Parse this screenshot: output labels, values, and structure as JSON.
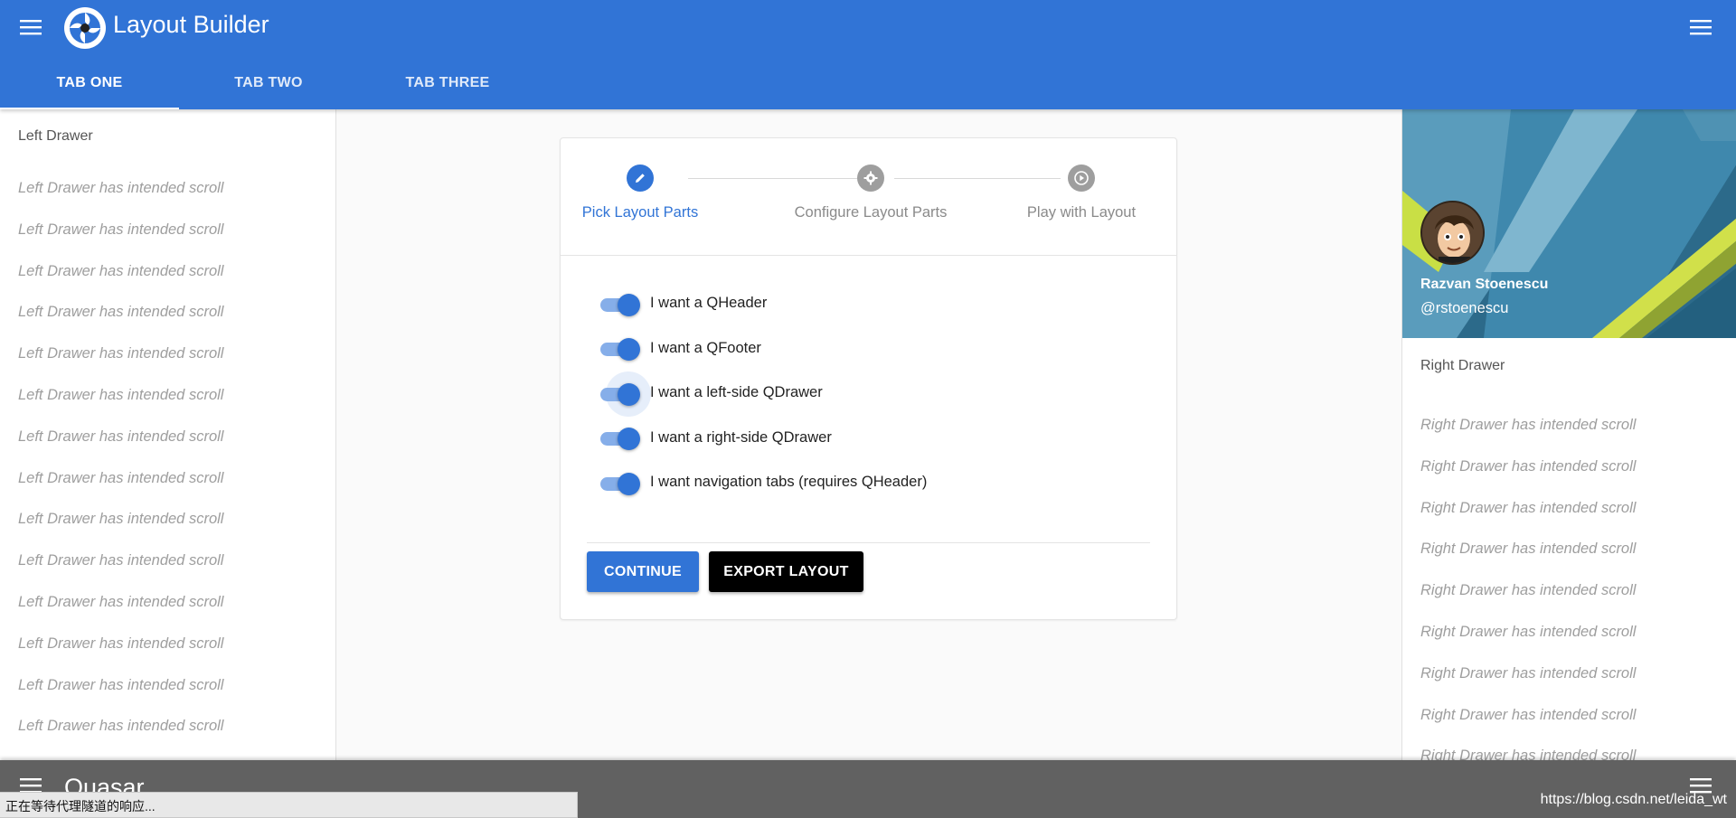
{
  "header": {
    "title": "Layout Builder",
    "tabs": [
      {
        "label": "TAB ONE",
        "active": true
      },
      {
        "label": "TAB TWO",
        "active": false
      },
      {
        "label": "TAB THREE",
        "active": false
      }
    ]
  },
  "left_drawer": {
    "title": "Left Drawer",
    "scroll_text": "Left Drawer has intended scroll",
    "scroll_count": 14
  },
  "right_drawer": {
    "title": "Right Drawer",
    "scroll_text": "Right Drawer has intended scroll",
    "scroll_count": 9,
    "profile": {
      "name": "Razvan Stoenescu",
      "handle": "@rstoenescu"
    }
  },
  "stepper": {
    "steps": [
      {
        "label": "Pick Layout Parts",
        "icon": "edit-icon",
        "active": true
      },
      {
        "label": "Configure Layout Parts",
        "icon": "gear-icon",
        "active": false
      },
      {
        "label": "Play with Layout",
        "icon": "play-icon",
        "active": false
      }
    ]
  },
  "options": [
    {
      "label": "I want a QHeader",
      "checked": true
    },
    {
      "label": "I want a QFooter",
      "checked": true
    },
    {
      "label": "I want a left-side QDrawer",
      "checked": true,
      "focused": true
    },
    {
      "label": "I want a right-side QDrawer",
      "checked": true
    },
    {
      "label": "I want navigation tabs (requires QHeader)",
      "checked": true
    }
  ],
  "actions": {
    "continue_label": "CONTINUE",
    "export_label": "EXPORT LAYOUT"
  },
  "footer": {
    "title": "Quasar"
  },
  "browser": {
    "status_text": "正在等待代理隧道的响应...",
    "watermark": "https://blog.csdn.net/leida_wt"
  },
  "colors": {
    "primary": "#3174d6",
    "footer_bg": "#616161",
    "export_button": "#000000"
  }
}
